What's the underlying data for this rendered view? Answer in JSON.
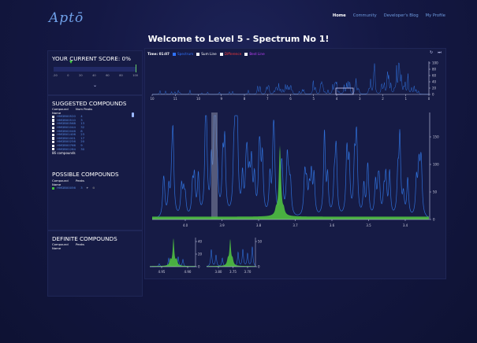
{
  "header": {
    "logo": "Aptō",
    "nav": [
      {
        "label": "Home",
        "active": true
      },
      {
        "label": "Community",
        "active": false
      },
      {
        "label": "Developer's Blog",
        "active": false
      },
      {
        "label": "My Profile",
        "active": false
      }
    ]
  },
  "welcome": "Welcome to Level 5 - Spectrum No 1!",
  "score": {
    "title": "YOUR CURRENT SCORE: 0%",
    "ticks": [
      "-20",
      "0",
      "20",
      "40",
      "60",
      "80",
      "100"
    ]
  },
  "suggested": {
    "title": "SUGGESTED COMPOUNDS",
    "col_name": "Compound Name",
    "col_peaks": "Num Peaks",
    "rows": [
      {
        "name": "HMDB00520",
        "peaks": "4"
      },
      {
        "name": "HMDB00510",
        "peaks": "3"
      },
      {
        "name": "HMDB00568",
        "peaks": "13"
      },
      {
        "name": "HMDB01044",
        "peaks": "32"
      },
      {
        "name": "HMDB02046",
        "peaks": "8"
      },
      {
        "name": "HMDB01406",
        "peaks": "23"
      },
      {
        "name": "HMDB01001",
        "peaks": "17"
      },
      {
        "name": "HMDB00256",
        "peaks": "20"
      },
      {
        "name": "HMDB00766",
        "peaks": "9"
      },
      {
        "name": "HMDB01284",
        "peaks": "30"
      }
    ],
    "count_label": "86 compounds"
  },
  "possible": {
    "title": "POSSIBLE COMPOUNDS",
    "col_name": "Compound Name",
    "col_peaks": "Peaks",
    "rows": [
      {
        "name": "HMDB00056",
        "peaks": "3",
        "add": "+",
        "remove": "⊗",
        "color": "#3fbf3f"
      }
    ]
  },
  "definite": {
    "title": "DEFINITE COMPOUNDS",
    "col_name": "Compound Name",
    "col_peaks": "Peaks"
  },
  "toolbar": {
    "time": "Time: 01:07",
    "items": [
      {
        "label": "Spectrum",
        "color": "#2f72ff"
      },
      {
        "label": "Sum Line",
        "color": "#ffffff"
      },
      {
        "label": "Difference",
        "color": "#ff3a3a"
      },
      {
        "label": "Best Line",
        "color": "#c040ff"
      }
    ],
    "refresh_icon": "refresh-icon",
    "skip_icon": "skip-forward-icon"
  },
  "overview_axis": {
    "x_ticks": [
      "10",
      "11",
      "10",
      "9",
      "8",
      "7",
      "6",
      "5",
      "4",
      "3",
      "2",
      "1",
      "0"
    ],
    "y_ticks": [
      "100",
      "80",
      "60",
      "40",
      "20",
      "0"
    ]
  },
  "main_axis": {
    "x_ticks": [
      "4.0",
      "3.9",
      "3.8",
      "3.7",
      "3.6",
      "3.5",
      "3.4"
    ],
    "y_ticks": [
      "150",
      "100",
      "50",
      "0"
    ]
  },
  "zoom1_axis": {
    "x_ticks": [
      "4.95",
      "4.90"
    ],
    "y_ticks": [
      "40",
      "20",
      "0"
    ]
  },
  "zoom2_axis": {
    "x_ticks": [
      "3.80",
      "3.75",
      "3.70"
    ],
    "y_ticks": [
      "50",
      "0"
    ]
  },
  "colors": {
    "spectrum": "#2f6fd8",
    "compound": "#4fc040",
    "accent": "#6f9ce0"
  }
}
